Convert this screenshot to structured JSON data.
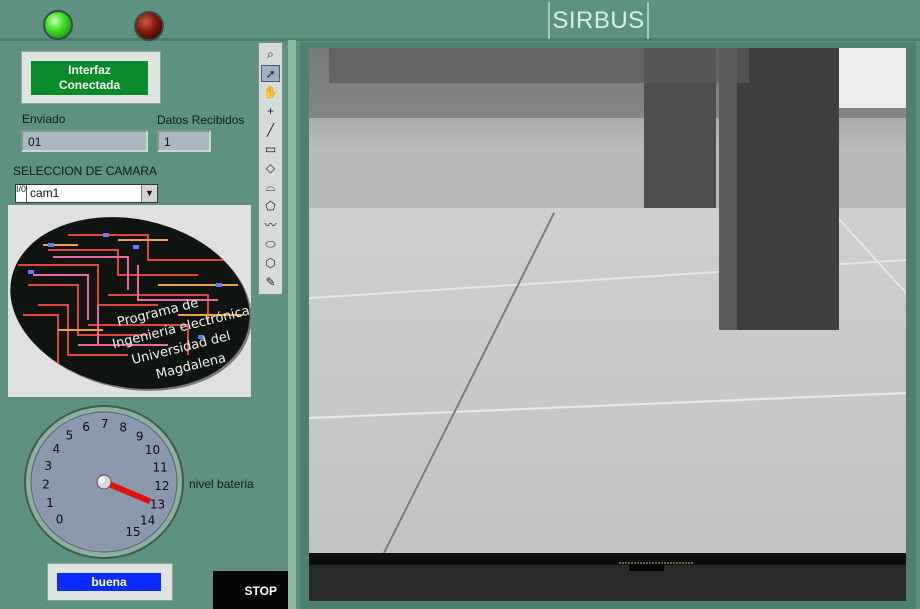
{
  "title": "SIRBUS",
  "leds": {
    "connected_color": "#4ee332",
    "error_color": "#7e170c"
  },
  "status": {
    "line1": "Interfaz",
    "line2": "Conectada",
    "color": "#0a8a2a"
  },
  "enviado": {
    "label": "Enviado",
    "value": "01"
  },
  "recibidos": {
    "label": "Datos Recibidos",
    "value": "1"
  },
  "camera_select": {
    "label": "SELECCION DE CAMARA",
    "index_glyph": "I/0",
    "value": "cam1"
  },
  "logo": {
    "lines": [
      "Programa de",
      "Ingeniería electrónica",
      "Universidad del",
      "Magdalena"
    ]
  },
  "gauge": {
    "label": "nivel bateria",
    "value": 13,
    "min": 0,
    "max": 15,
    "ticks": [
      "0",
      "1",
      "2",
      "3",
      "4",
      "5",
      "6",
      "7",
      "8",
      "9",
      "10",
      "11",
      "12",
      "13",
      "14",
      "15"
    ]
  },
  "bateria": {
    "value": "buena",
    "color": "#0c2cff"
  },
  "stop": {
    "label": "STOP"
  },
  "palette": {
    "tools": [
      {
        "name": "zoom-icon",
        "glyph": "⌕"
      },
      {
        "name": "pointer-icon",
        "glyph": "➚"
      },
      {
        "name": "pan-icon",
        "glyph": "✋"
      },
      {
        "name": "crosshair-icon",
        "glyph": "+"
      },
      {
        "name": "line-icon",
        "glyph": "╱"
      },
      {
        "name": "rectangle-icon",
        "glyph": "▭"
      },
      {
        "name": "rotated-rect-icon",
        "glyph": "◇"
      },
      {
        "name": "annulus-icon",
        "glyph": "⌓"
      },
      {
        "name": "polygon-icon",
        "glyph": "⬠"
      },
      {
        "name": "freehand-icon",
        "glyph": "〰"
      },
      {
        "name": "oval-icon",
        "glyph": "⬭"
      },
      {
        "name": "hexagon-icon",
        "glyph": "⬡"
      },
      {
        "name": "annotation-icon",
        "glyph": "✎"
      }
    ]
  }
}
